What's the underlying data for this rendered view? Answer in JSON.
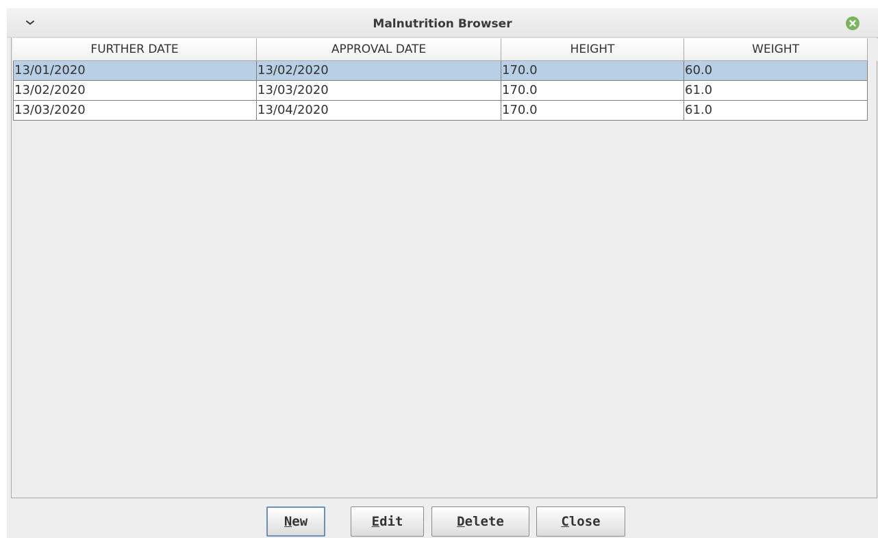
{
  "window": {
    "title": "Malnutrition Browser"
  },
  "icons": {
    "menu": "chevron-down-icon",
    "close": "close-circle-icon"
  },
  "table": {
    "columns": [
      "FURTHER DATE",
      "APPROVAL DATE",
      "HEIGHT",
      "WEIGHT"
    ],
    "rows": [
      {
        "further_date": "13/01/2020",
        "approval_date": "13/02/2020",
        "height": "170.0",
        "weight": "60.0",
        "selected": true
      },
      {
        "further_date": "13/02/2020",
        "approval_date": "13/03/2020",
        "height": "170.0",
        "weight": "61.0",
        "selected": false
      },
      {
        "further_date": "13/03/2020",
        "approval_date": "13/04/2020",
        "height": "170.0",
        "weight": "61.0",
        "selected": false
      }
    ]
  },
  "buttons": {
    "new": {
      "mnemonic": "N",
      "rest": "ew"
    },
    "edit": {
      "mnemonic": "E",
      "rest": "dit"
    },
    "delete": {
      "mnemonic": "D",
      "rest": "elete"
    },
    "close": {
      "mnemonic": "C",
      "rest": "lose"
    }
  },
  "colors": {
    "selection": "#b8cfe5",
    "close_button": "#7ab55c"
  }
}
